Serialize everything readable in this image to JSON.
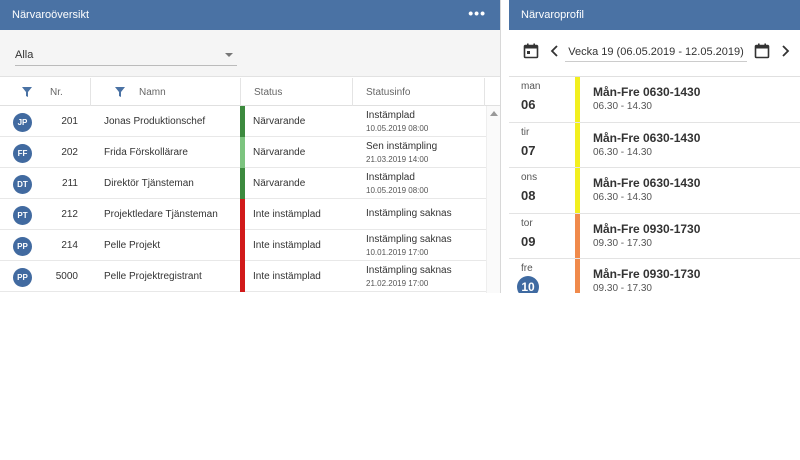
{
  "left_panel": {
    "title": "Närvaroöversikt",
    "menu_label": "•••",
    "filter": {
      "selected": "Alla"
    },
    "columns": {
      "nr": "Nr.",
      "name": "Namn",
      "status": "Status",
      "statusinfo": "Statusinfo"
    },
    "rows": [
      {
        "initials": "JP",
        "nr": "201",
        "name": "Jonas Produktionschef",
        "status": "Närvarande",
        "status_color": "#3c8a3e",
        "info_title": "Instämplad",
        "info_time": "10.05.2019 08:00"
      },
      {
        "initials": "FF",
        "nr": "202",
        "name": "Frida Förskollärare",
        "status": "Närvarande",
        "status_color": "#7cc47f",
        "info_title": "Sen instämpling",
        "info_time": "21.03.2019 14:00"
      },
      {
        "initials": "DT",
        "nr": "211",
        "name": "Direktör Tjänsteman",
        "status": "Närvarande",
        "status_color": "#3c8a3e",
        "info_title": "Instämplad",
        "info_time": "10.05.2019 08:00"
      },
      {
        "initials": "PT",
        "nr": "212",
        "name": "Projektledare Tjänsteman",
        "status": "Inte instämplad",
        "status_color": "#d11a1a",
        "info_title": "Instämpling saknas",
        "info_time": ""
      },
      {
        "initials": "PP",
        "nr": "214",
        "name": "Pelle Projekt",
        "status": "Inte instämplad",
        "status_color": "#d11a1a",
        "info_title": "Instämpling saknas",
        "info_time": "10.01.2019 17:00"
      },
      {
        "initials": "PP",
        "nr": "5000",
        "name": "Pelle Projektregistrant",
        "status": "Inte instämplad",
        "status_color": "#d11a1a",
        "info_title": "Instämpling saknas",
        "info_time": "21.02.2019 17:00"
      }
    ]
  },
  "right_panel": {
    "title": "Närvaroprofil",
    "week_label": "Vecka 19 (06.05.2019 - 12.05.2019)",
    "days": [
      {
        "name": "man",
        "num": "06",
        "today": false,
        "color": "#f2ef1f",
        "shift": "Mån-Fre 0630-1430",
        "time": "06.30 - 14.30"
      },
      {
        "name": "tir",
        "num": "07",
        "today": false,
        "color": "#f2ef1f",
        "shift": "Mån-Fre 0630-1430",
        "time": "06.30 - 14.30"
      },
      {
        "name": "ons",
        "num": "08",
        "today": false,
        "color": "#f2ef1f",
        "shift": "Mån-Fre 0630-1430",
        "time": "06.30 - 14.30"
      },
      {
        "name": "tor",
        "num": "09",
        "today": false,
        "color": "#f08a4b",
        "shift": "Mån-Fre 0930-1730",
        "time": "09.30 - 17.30"
      },
      {
        "name": "fre",
        "num": "10",
        "today": true,
        "color": "#f08a4b",
        "shift": "Mån-Fre 0930-1730",
        "time": "09.30 - 17.30"
      }
    ]
  },
  "icons": {
    "filter": "funnel-icon",
    "calendar": "calendar-icon",
    "prev": "chevron-left-icon",
    "next": "chevron-right-icon",
    "menu": "more-horizontal-icon"
  },
  "colors": {
    "header": "#4a72a4",
    "avatar": "#416aa0"
  }
}
